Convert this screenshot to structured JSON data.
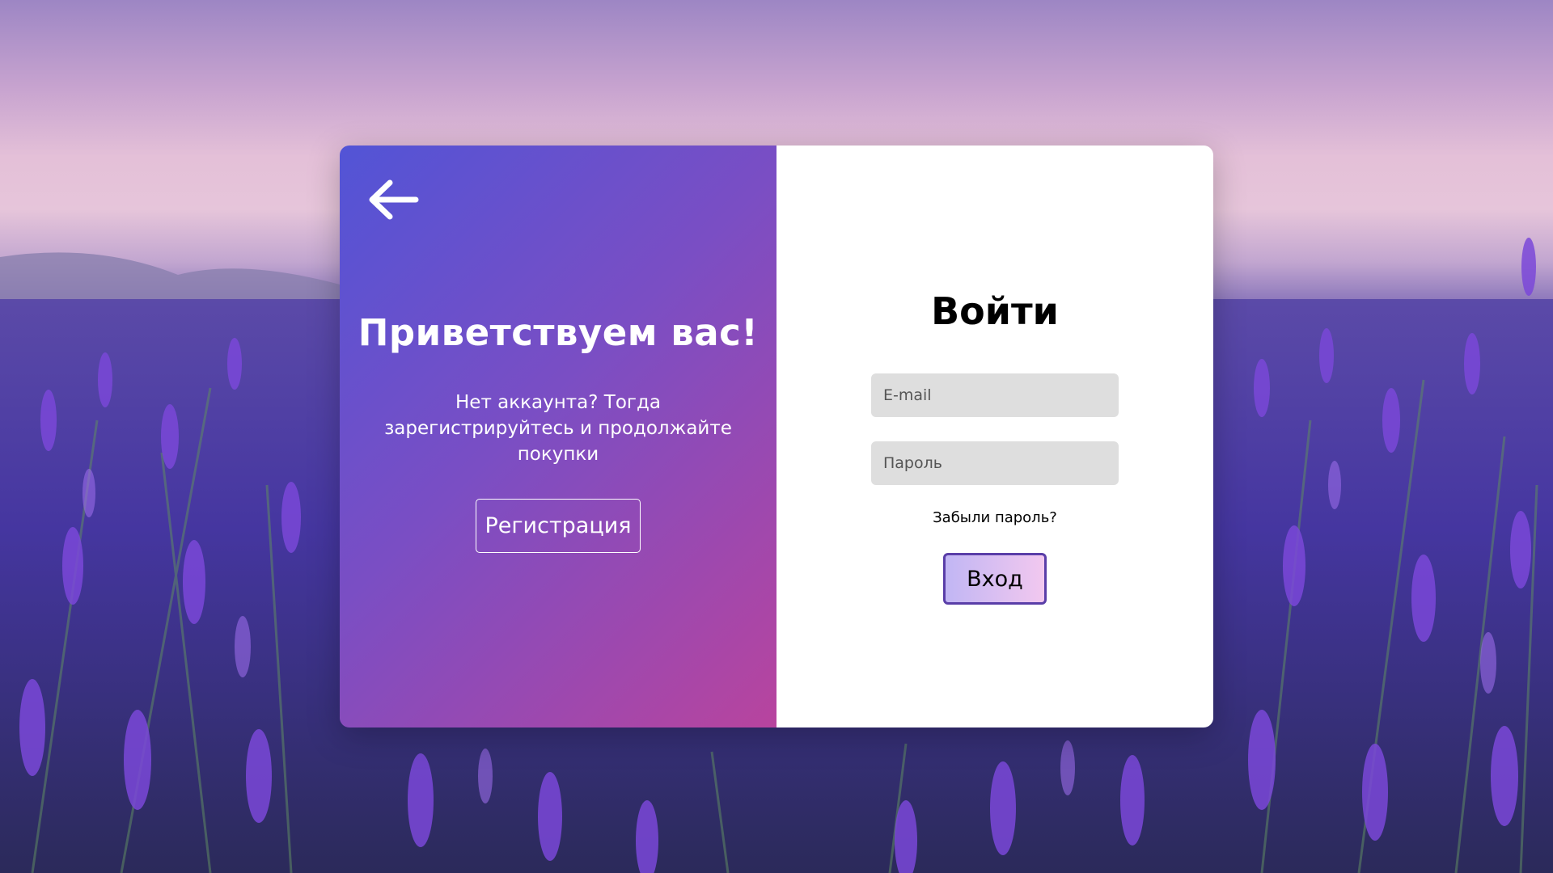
{
  "background": {
    "description_icon": "lavender-field-background"
  },
  "left_panel": {
    "back_icon": "arrow-left-icon",
    "title": "Приветствуем вас!",
    "text": "Нет аккаунта? Тогда зарегистрируйтесь и продолжайте покупки",
    "register_label": "Регистрация"
  },
  "right_panel": {
    "title": "Войти",
    "email_placeholder": "E-mail",
    "password_placeholder": "Пароль",
    "forgot_label": "Забыли пароль?",
    "login_label": "Вход"
  },
  "colors": {
    "gradient_start": "#5254d6",
    "gradient_end": "#b8449e",
    "button_border": "#5a3ea8",
    "field_bg": "#dedede"
  }
}
